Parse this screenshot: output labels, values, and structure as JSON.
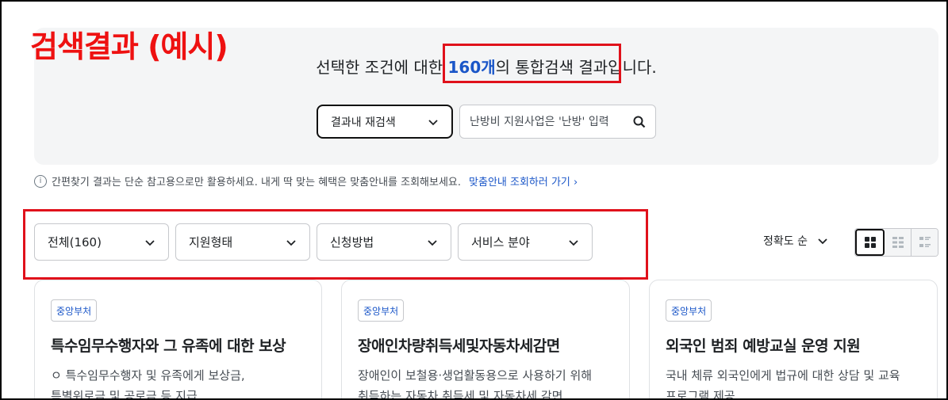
{
  "annotation": {
    "example_title": "검색결과 (예시)"
  },
  "summary": {
    "prefix": "선택한 조건에 대한 ",
    "count": "160개",
    "suffix": "의 통합검색 결과입니다."
  },
  "search": {
    "select_label": "결과내 재검색",
    "placeholder": "난방비 지원사업은 '난방' 입력"
  },
  "notice": {
    "info_icon": "i",
    "text": "간편찾기 결과는 단순 참고용으로만 활용하세요. 내게 딱 맞는 혜택은 맞춤안내를 조회해보세요.",
    "link": "맞춤안내 조회하러 가기",
    "link_chevron": "›"
  },
  "filters": [
    "전체(160)",
    "지원형태",
    "신청방법",
    "서비스 분야"
  ],
  "sort": {
    "label": "정확도 순"
  },
  "cards": [
    {
      "badge": "중앙부처",
      "title": "특수임무수행자와 그 유족에 대한 보상",
      "desc1": "ㅇ 특수임무수행자 및 유족에게 보상금,",
      "desc2": "특별위로금 및 공로금 등 지급"
    },
    {
      "badge": "중앙부처",
      "title": "장애인차량취득세및자동차세감면",
      "desc1": "장애인이 보철용·생업활동용으로 사용하기 위해",
      "desc2": "취득하는 자동차 취득세 및 자동차세 감면"
    },
    {
      "badge": "중앙부처",
      "title": "외국인 범죄 예방교실 운영 지원",
      "desc1": "국내 체류 외국인에게 법규에 대한 상담 및 교육",
      "desc2": "프로그램 제공"
    }
  ],
  "colors": {
    "accent": "#1a56c8",
    "annotation_red": "#e0111b",
    "hero_bg": "#f4f5f6"
  }
}
